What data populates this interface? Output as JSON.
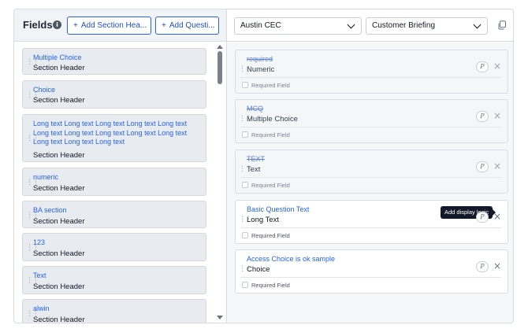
{
  "left_panel": {
    "title": "Fields",
    "info_icon": "i",
    "add_section_label": "Add Section Hea...",
    "add_question_label": "Add Questi...",
    "plus": "+",
    "items": [
      {
        "link": "Multiple Choice",
        "sub": "Section Header"
      },
      {
        "link": "Choice",
        "sub": "Section Header"
      },
      {
        "link": "Long text Long text Long text Long text Long text Long text Long text Long text Long text Long text Long text Long text Long text",
        "sub": "Section Header"
      },
      {
        "link": "numeric",
        "sub": "Section Header"
      },
      {
        "link": "BA section",
        "sub": "Section Header"
      },
      {
        "link": "123",
        "sub": "Section Header"
      },
      {
        "link": "Text",
        "sub": "Section Header"
      },
      {
        "link": "alwin",
        "sub": "Section Header"
      }
    ]
  },
  "right_panel": {
    "location_select": "Austin CEC",
    "template_select": "Customer Briefing",
    "logic_glyph": "P",
    "close_glyph": "×",
    "tooltip": "Add display logic",
    "questions": [
      {
        "title": "required",
        "type": "Numeric",
        "required_label": "Required Field",
        "disabled": true
      },
      {
        "title": "MCQ",
        "type": "Multiple Choice",
        "required_label": "Required Field",
        "disabled": true
      },
      {
        "title": "TEXT",
        "type": "Text",
        "required_label": "Required Field",
        "disabled": true
      },
      {
        "title": "Basic Question Text",
        "type": "Long Text",
        "required_label": "Required Field",
        "disabled": false
      },
      {
        "title": "Access Choice is ok sample",
        "type": "Choice",
        "required_label": "Required Field",
        "disabled": false
      }
    ]
  },
  "colors": {
    "accent": "#2563eb",
    "tooltip_bg": "#111827",
    "card_bg": "#e8ebef"
  },
  "icons": [
    "info-icon",
    "plus-icon",
    "drag-handle-icon",
    "chevron-down-icon",
    "copy-icon",
    "display-logic-icon",
    "close-icon",
    "scroll-up-icon",
    "scroll-down-icon"
  ]
}
